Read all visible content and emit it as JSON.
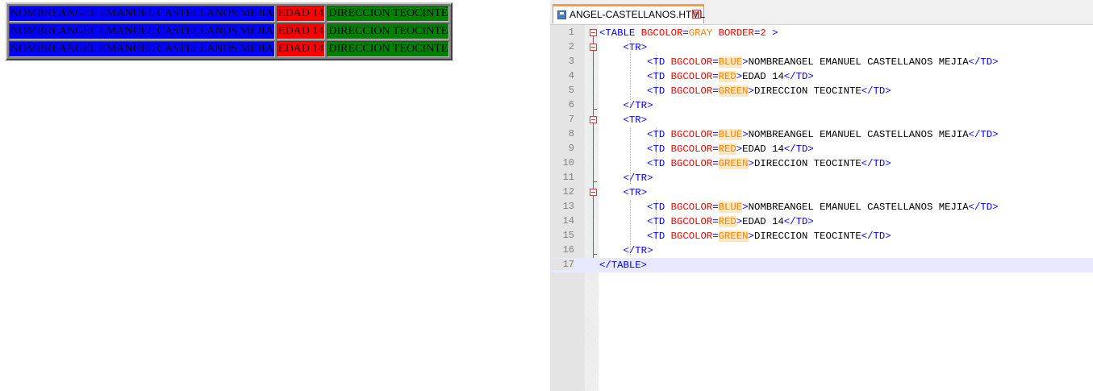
{
  "preview": {
    "rows": [
      {
        "name": "NOMBREANGEL EMANUEL CASTELLANOS MEJIA",
        "age": "EDAD 14",
        "address": "DIRECCION TEOCINTE"
      },
      {
        "name": "NOMBREANGEL EMANUEL CASTELLANOS MEJIA",
        "age": "EDAD 14",
        "address": "DIRECCION TEOCINTE"
      },
      {
        "name": "NOMBREANGEL EMANUEL CASTELLANOS MEJIA",
        "age": "EDAD 14",
        "address": "DIRECCION TEOCINTE"
      }
    ],
    "colors": {
      "table_bg": "#808080",
      "name_bg": "#0000ff",
      "age_bg": "#ff0000",
      "address_bg": "#008000"
    }
  },
  "editor": {
    "tab_title": "ANGEL-CASTELLANOS.HTML",
    "current_line": 17,
    "line_numbers": [
      "1",
      "2",
      "3",
      "4",
      "5",
      "6",
      "7",
      "8",
      "9",
      "10",
      "11",
      "12",
      "13",
      "14",
      "15",
      "16",
      "17"
    ],
    "code": {
      "table_open": "TABLE",
      "attr_bgcolor": "BGCOLOR",
      "val_gray": "GRAY",
      "attr_border": "BORDER",
      "val_border": "2",
      "tr": "TR",
      "td": "TD",
      "val_blue": "BLUE",
      "val_red": "RED",
      "val_green": "GREEN",
      "text_name": "NOMBREANGEL EMANUEL CASTELLANOS MEJIA",
      "text_age": "EDAD 14",
      "text_address": "DIRECCION TEOCINTE",
      "table_close": "TABLE"
    },
    "colors": {
      "tag": "#0000ff",
      "attribute": "#ff0000",
      "value_highlight": "#ffe8c0",
      "fold_marker": "#c54040",
      "tab_accent": "#f5a033"
    }
  }
}
